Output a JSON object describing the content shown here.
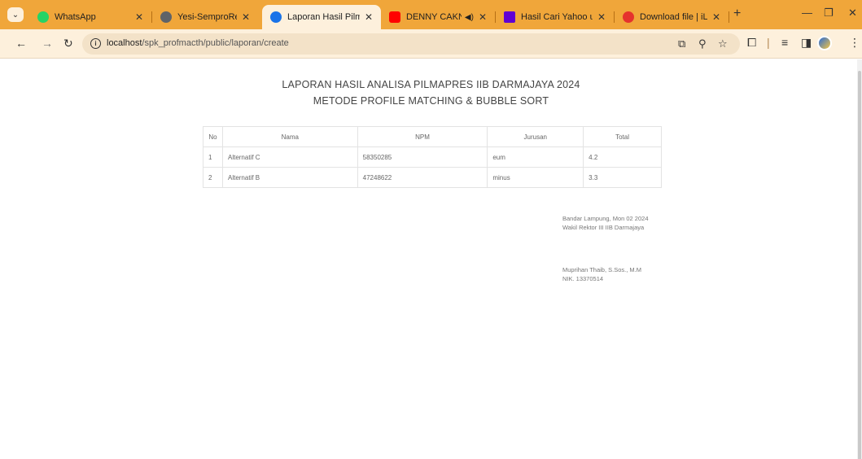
{
  "browser": {
    "tabs": [
      {
        "title": "WhatsApp",
        "icon": "whatsapp-icon",
        "color": "#25d366",
        "active": false
      },
      {
        "title": "Yesi-SemproRevisirev",
        "icon": "web-icon",
        "color": "#5f6368",
        "active": false
      },
      {
        "title": "Laporan Hasil Pilmap",
        "icon": "globe-icon",
        "color": "#1a73e8",
        "active": true
      },
      {
        "title": "DENNY CAKNAN",
        "icon": "youtube-icon",
        "color": "#ff0000",
        "active": false
      },
      {
        "title": "Hasil Cari Yahoo untu",
        "icon": "yahoo-icon",
        "color": "#6001d2",
        "active": false
      },
      {
        "title": "Download file | iLove",
        "icon": "ilovepdf-icon",
        "color": "#e5322d",
        "active": false
      }
    ],
    "new_tab": "+",
    "address_bar": {
      "host": "localhost",
      "path": "/spk_profmacth/public/laporan/create"
    }
  },
  "report": {
    "title": "LAPORAN HASIL ANALISA PILMAPRES IIB DARMAJAYA 2024",
    "subtitle": "METODE PROFILE MATCHING & BUBBLE SORT",
    "columns": [
      "No",
      "Nama",
      "NPM",
      "Jurusan",
      "Total"
    ],
    "rows": [
      {
        "no": "1",
        "nama": "Alternatif C",
        "npm": "58350285",
        "jurusan": "eum",
        "total": "4.2"
      },
      {
        "no": "2",
        "nama": "Alternatif B",
        "npm": "47248622",
        "jurusan": "minus",
        "total": "3.3"
      }
    ],
    "signature": {
      "place_date": "Bandar Lampung, Mon 02 2024",
      "position": "Wakil Rektor III IIB Darmajaya",
      "name": "Muprihan Thaib, S.Sos., M.M",
      "nik": "NIK. 13370514"
    }
  }
}
